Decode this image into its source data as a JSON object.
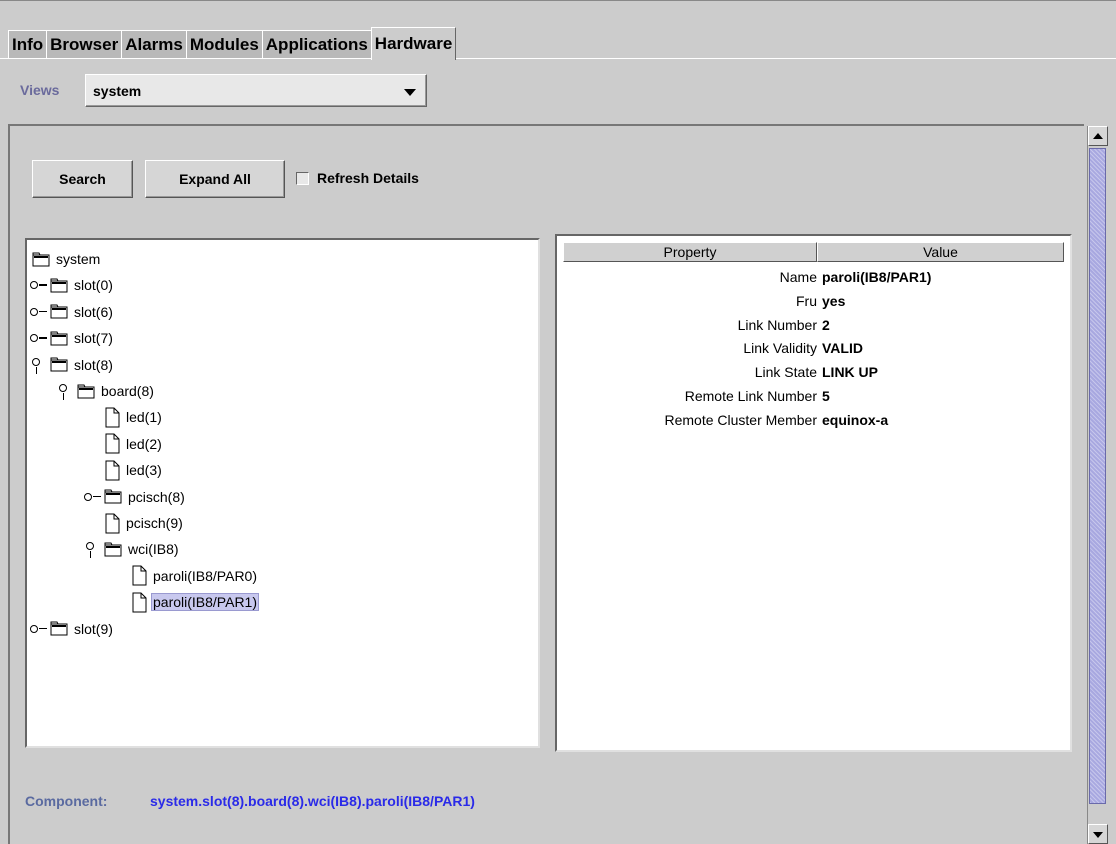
{
  "tabs": [
    {
      "label": "Info",
      "active": false
    },
    {
      "label": "Browser",
      "active": false
    },
    {
      "label": "Alarms",
      "active": false
    },
    {
      "label": "Modules",
      "active": false
    },
    {
      "label": "Applications",
      "active": false
    },
    {
      "label": "Hardware",
      "active": true
    }
  ],
  "views": {
    "label": "Views",
    "selected": "system"
  },
  "toolbar": {
    "search_label": "Search",
    "expand_all_label": "Expand All",
    "refresh_details_label": "Refresh Details",
    "refresh_details_checked": false
  },
  "tree": {
    "nodes": [
      {
        "label": "system",
        "type": "folder",
        "state": "none",
        "depth": 0
      },
      {
        "label": "slot(0)",
        "type": "folder",
        "state": "collapsed",
        "depth": 0
      },
      {
        "label": "slot(6)",
        "type": "folder",
        "state": "collapsed",
        "depth": 0
      },
      {
        "label": "slot(7)",
        "type": "folder",
        "state": "collapsed",
        "depth": 0
      },
      {
        "label": "slot(8)",
        "type": "folder",
        "state": "expanded",
        "depth": 0
      },
      {
        "label": "board(8)",
        "type": "folder",
        "state": "expanded",
        "depth": 1
      },
      {
        "label": "led(1)",
        "type": "leaf",
        "state": "none",
        "depth": 2
      },
      {
        "label": "led(2)",
        "type": "leaf",
        "state": "none",
        "depth": 2
      },
      {
        "label": "led(3)",
        "type": "leaf",
        "state": "none",
        "depth": 2
      },
      {
        "label": "pcisch(8)",
        "type": "folder",
        "state": "collapsed",
        "depth": 2
      },
      {
        "label": "pcisch(9)",
        "type": "leaf",
        "state": "none",
        "depth": 2
      },
      {
        "label": "wci(IB8)",
        "type": "folder",
        "state": "expanded",
        "depth": 2
      },
      {
        "label": "paroli(IB8/PAR0)",
        "type": "leaf",
        "state": "none",
        "depth": 3
      },
      {
        "label": "paroli(IB8/PAR1)",
        "type": "leaf",
        "state": "none",
        "depth": 3,
        "selected": true
      },
      {
        "label": "slot(9)",
        "type": "folder",
        "state": "collapsed",
        "depth": 0
      }
    ]
  },
  "properties": {
    "header_property": "Property",
    "header_value": "Value",
    "rows": [
      {
        "property": "Name",
        "value": "paroli(IB8/PAR1)"
      },
      {
        "property": "Fru",
        "value": "yes"
      },
      {
        "property": "Link Number",
        "value": "2"
      },
      {
        "property": "Link Validity",
        "value": "VALID"
      },
      {
        "property": "Link State",
        "value": "LINK UP"
      },
      {
        "property": "Remote Link Number",
        "value": "5"
      },
      {
        "property": "Remote Cluster Member",
        "value": "equinox-a"
      }
    ]
  },
  "component": {
    "label": "Component:",
    "path": "system.slot(8).board(8).wci(IB8).paroli(IB8/PAR1)"
  }
}
